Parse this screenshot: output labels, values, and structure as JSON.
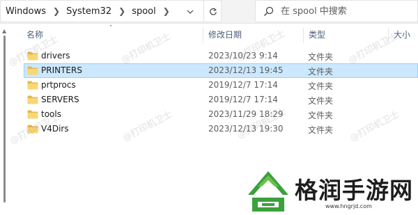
{
  "address_bar": {
    "breadcrumbs": [
      "Windows",
      "System32",
      "spool"
    ],
    "icons": [
      "chevron-down-icon",
      "refresh-icon"
    ]
  },
  "search": {
    "placeholder": "在 spool 中搜索",
    "icon": "search-icon"
  },
  "columns": {
    "name": "名称",
    "modified": "修改日期",
    "type": "类型",
    "size": "大小",
    "sorted_by": "name"
  },
  "files": [
    {
      "name": "drivers",
      "modified": "2023/10/23 9:14",
      "type": "文件夹",
      "selected": false
    },
    {
      "name": "PRINTERS",
      "modified": "2023/12/13 19:45",
      "type": "文件夹",
      "selected": true
    },
    {
      "name": "prtprocs",
      "modified": "2019/12/7 17:14",
      "type": "文件夹",
      "selected": false
    },
    {
      "name": "SERVERS",
      "modified": "2019/12/7 17:14",
      "type": "文件夹",
      "selected": false
    },
    {
      "name": "tools",
      "modified": "2023/11/29 18:29",
      "type": "文件夹",
      "selected": false
    },
    {
      "name": "V4Dirs",
      "modified": "2023/12/13 19:30",
      "type": "文件夹",
      "selected": false
    }
  ],
  "watermark_text": "@打印机卫士",
  "brand": {
    "name": "格润手游网",
    "url": "www.hngrjd.com"
  },
  "colors": {
    "selection_fill": "#cce8ff",
    "selection_border": "#99d1ff",
    "folder_yellow": "#f8d775",
    "header_text": "#4c607a",
    "brand_green": "#3aa13b"
  }
}
